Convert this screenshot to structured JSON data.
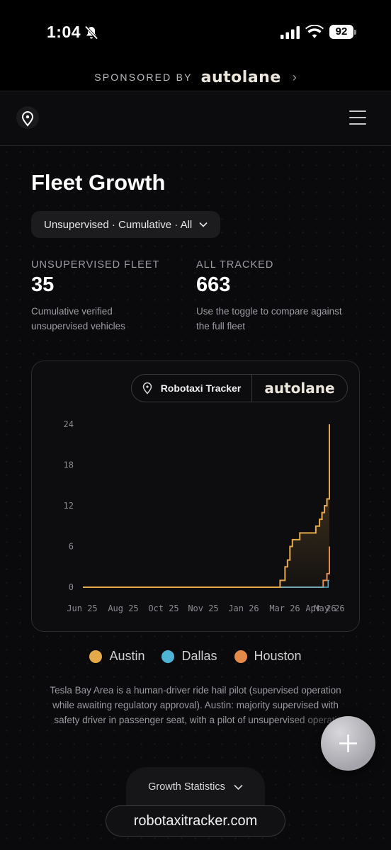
{
  "status_bar": {
    "time": "1:04",
    "battery": "92"
  },
  "sponsor": {
    "label": "SPONSORED BY",
    "brand": "autolane"
  },
  "page": {
    "title": "Fleet Growth",
    "filter_label": "Unsupervised · Cumulative · All"
  },
  "stats": [
    {
      "label": "UNSUPERVISED FLEET",
      "value": "35",
      "desc_line1": "Cumulative verified",
      "desc_line2": "unsupervised vehicles"
    },
    {
      "label": "ALL TRACKED",
      "value": "663",
      "desc_line1": "Use the toggle to compare against",
      "desc_line2": "the full fleet"
    }
  ],
  "chart_badge": {
    "left_label": "Robotaxi Tracker",
    "right_brand": "autolane"
  },
  "chart_data": {
    "type": "area",
    "x_tick_labels": [
      "Jun 25",
      "Aug 25",
      "Oct 25",
      "Nov 25",
      "Jan 26",
      "Mar 26",
      "Apr 26",
      "May 26"
    ],
    "y_ticks": [
      0,
      6,
      12,
      18,
      24
    ],
    "ylim": [
      0,
      24
    ],
    "grid": false,
    "series": [
      {
        "name": "Austin",
        "color": "#e6a94a",
        "values": [
          [
            0,
            0
          ],
          [
            0.79,
            0
          ],
          [
            0.8,
            1
          ],
          [
            0.81,
            1
          ],
          [
            0.82,
            3
          ],
          [
            0.83,
            4
          ],
          [
            0.84,
            6
          ],
          [
            0.85,
            7
          ],
          [
            0.87,
            7
          ],
          [
            0.88,
            8
          ],
          [
            0.94,
            8
          ],
          [
            0.945,
            9
          ],
          [
            0.96,
            10
          ],
          [
            0.97,
            11
          ],
          [
            0.98,
            12
          ],
          [
            0.99,
            13
          ],
          [
            1.0,
            15
          ],
          [
            1.005,
            17
          ],
          [
            1.01,
            20
          ],
          [
            1.015,
            22
          ],
          [
            1.02,
            24
          ]
        ]
      },
      {
        "name": "Dallas",
        "color": "#4fb3d6",
        "values": [
          [
            0,
            0
          ],
          [
            0.99,
            0
          ],
          [
            0.995,
            1
          ],
          [
            1.02,
            1
          ]
        ]
      },
      {
        "name": "Houston",
        "color": "#e68a4a",
        "values": [
          [
            0,
            0
          ],
          [
            0.97,
            0
          ],
          [
            0.975,
            1
          ],
          [
            0.99,
            2
          ],
          [
            1.0,
            2
          ],
          [
            1.01,
            3
          ],
          [
            1.015,
            5
          ],
          [
            1.02,
            6
          ]
        ]
      }
    ]
  },
  "legend": [
    {
      "name": "Austin",
      "color": "#e6a94a"
    },
    {
      "name": "Dallas",
      "color": "#4fb3d6"
    },
    {
      "name": "Houston",
      "color": "#e68a4a"
    }
  ],
  "note": {
    "line1": "Tesla Bay Area is a human-driver ride hail pilot (supervised operation",
    "line2": "while awaiting regulatory approval). Austin: majority supervised with",
    "line3": "safety driver in passenger seat, with a pilot of unsupervised operati"
  },
  "growth_stats_label": "Growth Statistics",
  "url": "robotaxitracker.com"
}
